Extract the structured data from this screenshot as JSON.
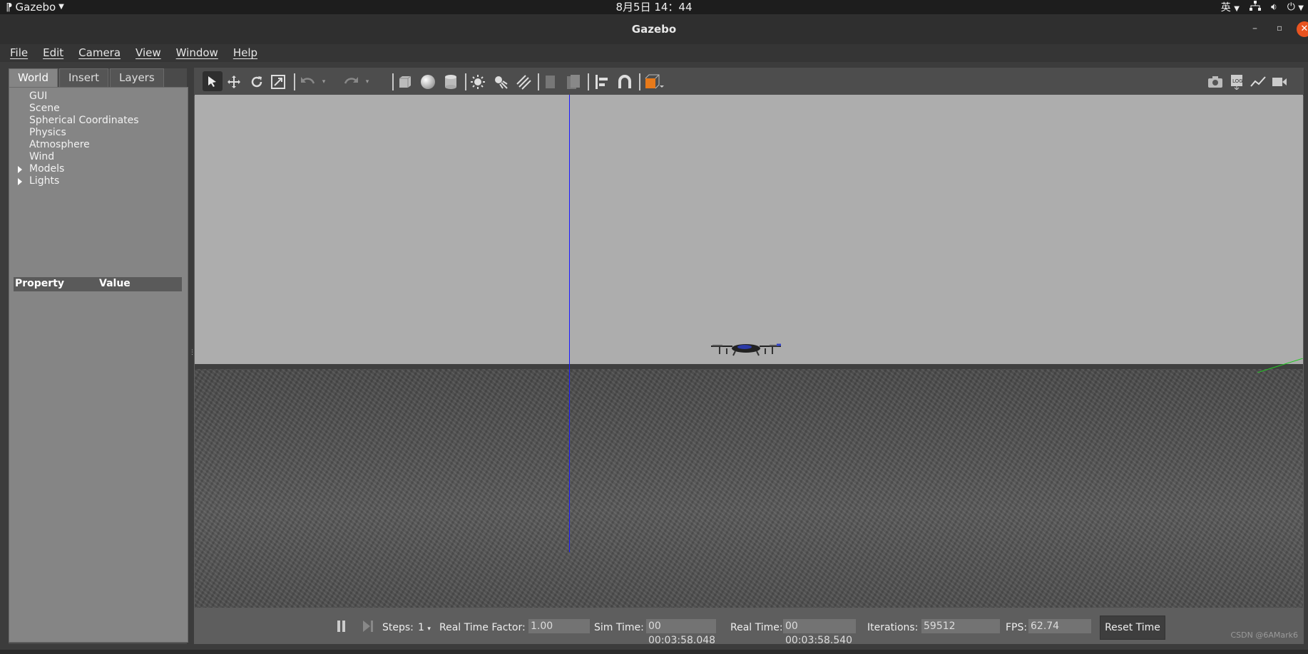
{
  "topbar": {
    "app_name": "Gazebo",
    "clock": "8月5日  14：44",
    "input_method": "英"
  },
  "window": {
    "title": "Gazebo"
  },
  "menu": [
    "File",
    "Edit",
    "Camera",
    "View",
    "Window",
    "Help"
  ],
  "left_panel": {
    "tabs": [
      "World",
      "Insert",
      "Layers"
    ],
    "active_tab": "World",
    "tree": [
      "GUI",
      "Scene",
      "Spherical Coordinates",
      "Physics",
      "Atmosphere",
      "Wind",
      "Models",
      "Lights"
    ],
    "expandable": [
      "Models",
      "Lights"
    ],
    "property_header": "Property",
    "value_header": "Value"
  },
  "toolbar": {
    "left_tools": [
      "select-arrow-icon",
      "translate-icon",
      "rotate-icon",
      "scale-icon",
      "undo-icon",
      "redo-icon",
      "box-icon",
      "sphere-icon",
      "cylinder-icon",
      "point-light-icon",
      "spot-light-icon",
      "directional-light-icon",
      "copy-icon",
      "paste-icon",
      "align-icon",
      "snap-magnet-icon",
      "view-angle-icon"
    ],
    "right_tools": [
      "screenshot-camera-icon",
      "log-icon",
      "plot-icon",
      "video-record-icon"
    ]
  },
  "status": {
    "steps_label": "Steps:",
    "steps_value": "1",
    "rtf_label": "Real Time Factor:",
    "rtf_value": "1.00",
    "sim_time_label": "Sim Time:",
    "sim_time_value": "00 00:03:58.048",
    "real_time_label": "Real Time:",
    "real_time_value": "00 00:03:58.540",
    "iterations_label": "Iterations:",
    "iterations_value": "59512",
    "fps_label": "FPS:",
    "fps_value": "62.74",
    "reset_label": "Reset Time"
  },
  "watermark": "CSDN @6AMark6",
  "colors": {
    "accent_orange": "#e95420",
    "sky": "#adadad",
    "axis_blue": "#1a1aff",
    "axis_green": "#22cc22"
  }
}
